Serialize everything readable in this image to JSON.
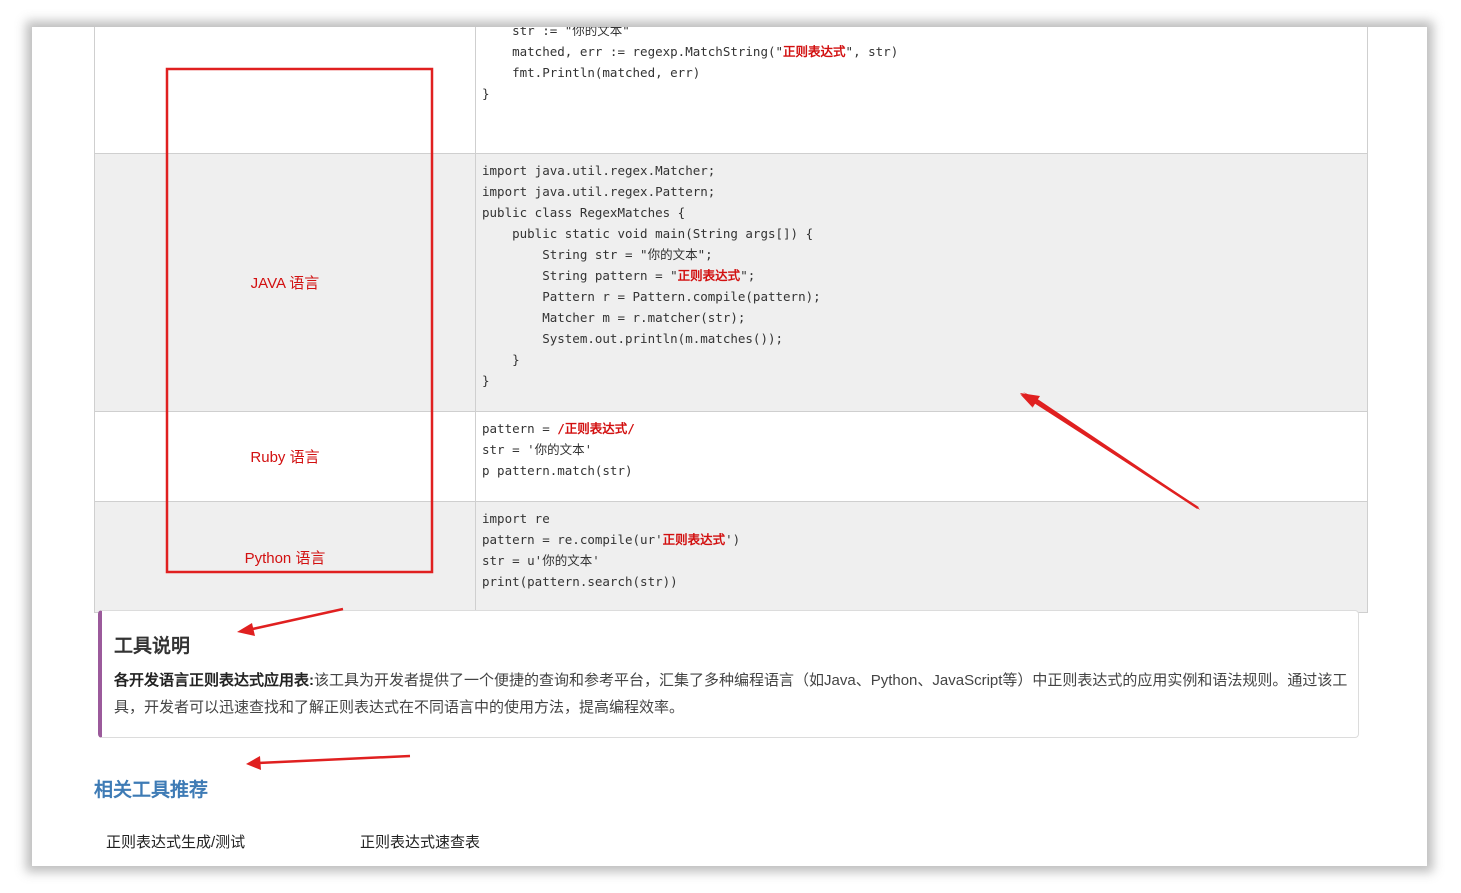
{
  "table": {
    "rows": [
      {
        "language": "",
        "shade": false,
        "code": [
          [
            {
              "t": "    str := \"你的文本\""
            }
          ],
          [
            {
              "t": "    matched, err := regexp.MatchString(\""
            },
            {
              "t": "正则表达式",
              "hl": true
            },
            {
              "t": "\", str)"
            }
          ],
          [
            {
              "t": "    fmt.Println(matched, err)"
            }
          ],
          [
            {
              "t": "}"
            }
          ]
        ]
      },
      {
        "language": "JAVA 语言",
        "shade": true,
        "code": [
          [
            {
              "t": "import java.util.regex.Matcher;"
            }
          ],
          [
            {
              "t": "import java.util.regex.Pattern;"
            }
          ],
          [
            {
              "t": "public class RegexMatches {"
            }
          ],
          [
            {
              "t": "    public static void main(String args[]) {"
            }
          ],
          [
            {
              "t": "        String str = \"你的文本\";"
            }
          ],
          [
            {
              "t": "        String pattern = \""
            },
            {
              "t": "正则表达式",
              "hl": true
            },
            {
              "t": "\";"
            }
          ],
          [
            {
              "t": "        Pattern r = Pattern.compile(pattern);"
            }
          ],
          [
            {
              "t": "        Matcher m = r.matcher(str);"
            }
          ],
          [
            {
              "t": "        System.out.println(m.matches());"
            }
          ],
          [
            {
              "t": "    }"
            }
          ],
          [
            {
              "t": "}"
            }
          ]
        ]
      },
      {
        "language": "Ruby 语言",
        "shade": false,
        "code": [
          [
            {
              "t": "pattern = "
            },
            {
              "t": "/正则表达式/",
              "hl": true
            }
          ],
          [
            {
              "t": "str = '你的文本'"
            }
          ],
          [
            {
              "t": "p pattern.match(str)"
            }
          ]
        ]
      },
      {
        "language": "Python 语言",
        "shade": true,
        "code": [
          [
            {
              "t": "import re"
            }
          ],
          [
            {
              "t": "pattern = re.compile(ur'"
            },
            {
              "t": "正则表达式",
              "hl": true
            },
            {
              "t": "')"
            }
          ],
          [
            {
              "t": "str = u'你的文本'"
            }
          ],
          [
            {
              "t": "print(pattern.search(str))"
            }
          ]
        ]
      }
    ]
  },
  "description": {
    "title": "工具说明",
    "bold_lead": "各开发语言正则表达式应用表:",
    "text": "该工具为开发者提供了一个便捷的查询和参考平台，汇集了多种编程语言（如Java、Python、JavaScript等）中正则表达式的应用实例和语法规则。通过该工具，开发者可以迅速查找和了解正则表达式在不同语言中的使用方法，提高编程效率。"
  },
  "related": {
    "title": "相关工具推荐",
    "links": [
      "正则表达式生成/测试",
      "正则表达式速查表"
    ]
  },
  "annotation_color": "#e02020"
}
